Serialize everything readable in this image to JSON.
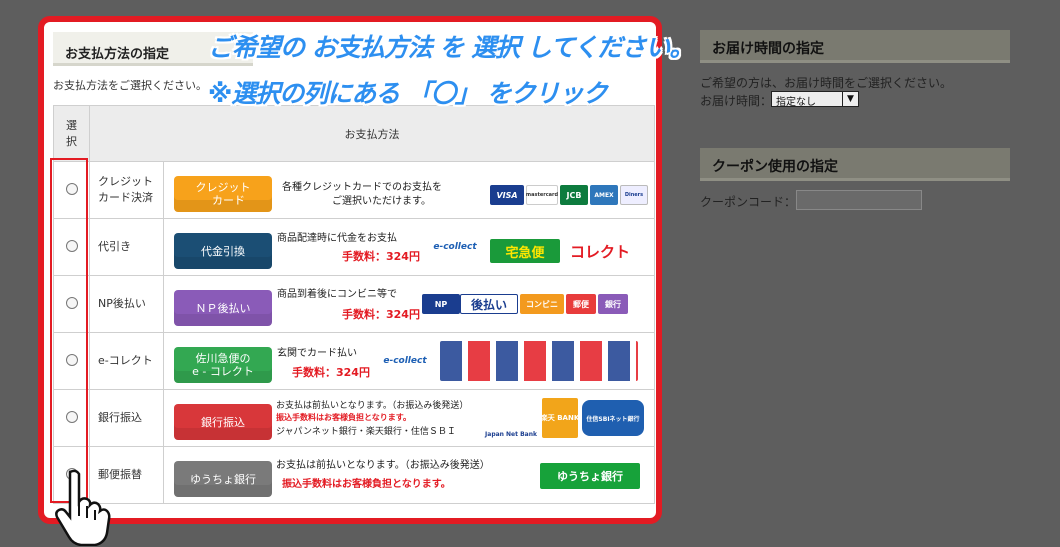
{
  "payment": {
    "heading": "お支払方法の指定",
    "subtitle": "お支払方法をご選択ください。",
    "col_select": "選\n択",
    "col_method": "お支払方法",
    "rows": [
      {
        "name": "クレジットカード決済",
        "button": "クレジット\n　カード",
        "button_color": "#f7a21b",
        "desc": "各種クレジットカードでのお支払を\n　　　　　ご選択いただけます。",
        "fee": "",
        "logos": [
          "VISA",
          "mastercard",
          "JCB",
          "AMEX",
          "Diners"
        ]
      },
      {
        "name": "代引き",
        "button": "代金引換",
        "button_color": "#1b4e74",
        "desc": "商品配達時に代金をお支払",
        "fee": "手数料：324円",
        "logos": [
          "e-collect",
          "宅急便",
          "コレクト"
        ]
      },
      {
        "name": "NP後払い",
        "button": "ＮＰ後払い",
        "button_color": "#8a5bb8",
        "desc": "商品到着後にコンビニ等で",
        "fee": "手数料：324円",
        "logos": [
          "NP",
          "後払い",
          "コンビニ",
          "郵便",
          "銀行"
        ]
      },
      {
        "name": "e-コレクト",
        "button": "佐川急便の\ne - コレクト",
        "button_color": "#33a852",
        "desc": "玄関でカード払い",
        "fee": "手数料：324円",
        "logos": [
          "e-collect",
          "card-grid"
        ]
      },
      {
        "name": "銀行振込",
        "button": "銀行振込",
        "button_color": "#d8373a",
        "desc": "お支払は前払いとなります。（お振込み後発送）",
        "fee": "振込手数料はお客様負担となります。",
        "banks": "ジャパンネット銀行・楽天銀行・住信ＳＢＩ",
        "logos": [
          "Japan Net Bank",
          "楽天 BANK",
          "住信SBIネット銀行"
        ]
      },
      {
        "name": "郵便振替",
        "button": "ゆうちょ銀行",
        "button_color": "#7a7a7a",
        "desc": "お支払は前払いとなります。（お振込み後発送）",
        "fee": "振込手数料はお客様負担となります。",
        "logos": [
          "ゆうちょ銀行"
        ]
      }
    ]
  },
  "overlay": {
    "line1": "ご希望の お支払方法 を 選択 してください。",
    "line2": "※選択の列にある 「〇」 をクリック"
  },
  "delivery": {
    "heading": "お届け時間の指定",
    "note": "ご希望の方は、お届け時間をご選択ください。",
    "label": "お届け時間：",
    "selected": "指定なし"
  },
  "coupon": {
    "heading": "クーポン使用の指定",
    "label": "クーポンコード："
  },
  "colors": {
    "highlight": "#e31b23",
    "overlay_text": "#2d8ff0",
    "fee_text": "#e31b23"
  }
}
